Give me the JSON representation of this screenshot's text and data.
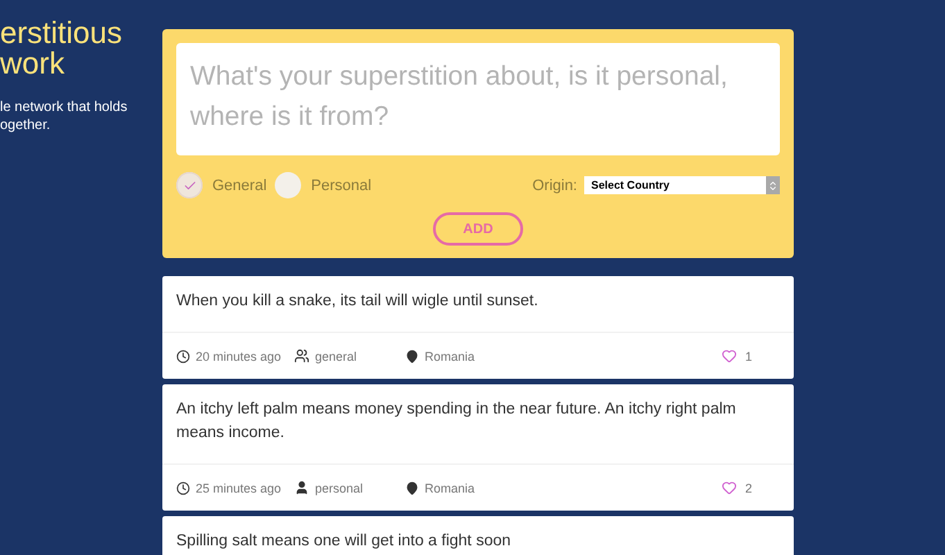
{
  "sidebar": {
    "title_lines": [
      "erstitious",
      "work"
    ],
    "description_lines": [
      "le network that holds",
      "ogether."
    ]
  },
  "form": {
    "placeholder": "What's your superstition about, is it personal, where is it from?",
    "types": [
      {
        "label": "General",
        "selected": true
      },
      {
        "label": "Personal",
        "selected": false
      }
    ],
    "origin_label": "Origin:",
    "country_select": "Select Country",
    "add_button": "ADD"
  },
  "posts": [
    {
      "text": "When you kill a snake, its tail will wigle until sunset.",
      "time": "20 minutes ago",
      "kind": "group",
      "category": "general",
      "country": "Romania",
      "likes": "1"
    },
    {
      "text": "An itchy left palm means money spending in the near future. An itchy right palm means income.",
      "time": "25 minutes ago",
      "kind": "single",
      "category": "personal",
      "country": "Romania",
      "likes": "2"
    },
    {
      "text": "Spilling salt means one will get into a fight soon"
    }
  ]
}
